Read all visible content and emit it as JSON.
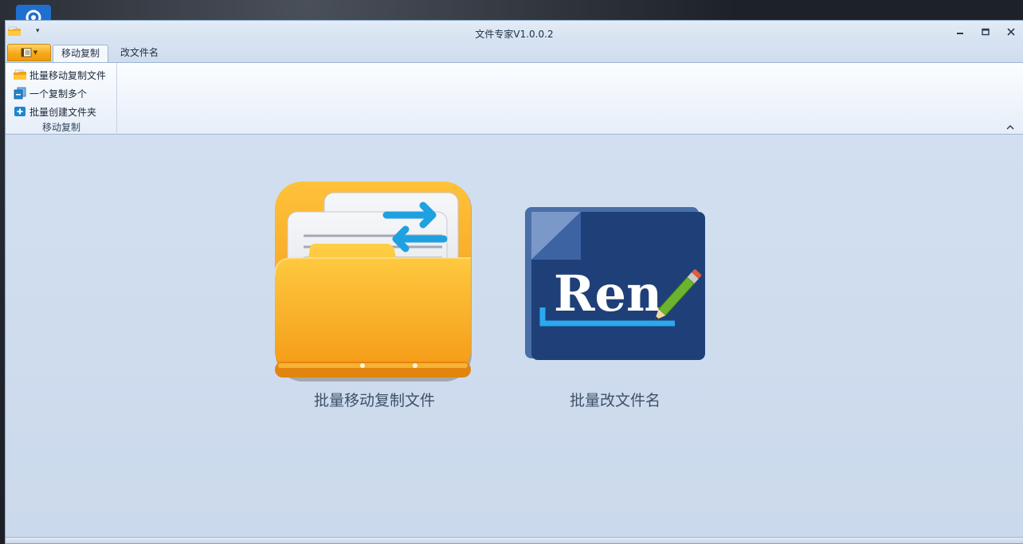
{
  "window": {
    "title": "文件专家V1.0.0.2",
    "qat_dropdown": "▾"
  },
  "tabs": [
    {
      "label": "移动复制",
      "active": true
    },
    {
      "label": "改文件名",
      "active": false
    }
  ],
  "ribbon": {
    "group_label": "移动复制",
    "items": [
      {
        "label": "批量移动复制文件",
        "icon": "folder-icon"
      },
      {
        "label": "一个复制多个",
        "icon": "copy-multiple-icon"
      },
      {
        "label": "批量创建文件夹",
        "icon": "new-folder-plus-icon"
      }
    ]
  },
  "tiles": [
    {
      "label": "批量移动复制文件",
      "icon": "folder-transfer-icon"
    },
    {
      "label": "批量改文件名",
      "icon": "rename-document-icon",
      "icon_text": "Ren"
    }
  ],
  "colors": {
    "accent_orange": "#f6a918",
    "ribbon_blue": "#1f3f78",
    "content_bg": "#d2dff0"
  }
}
